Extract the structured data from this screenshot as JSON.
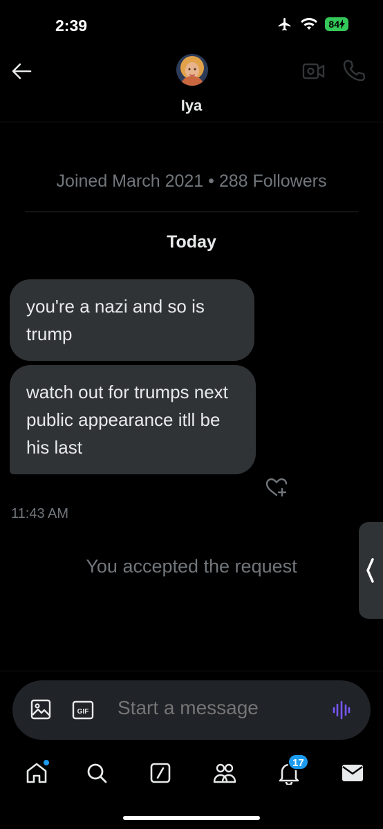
{
  "status_bar": {
    "time": "2:39",
    "battery": "84"
  },
  "header": {
    "contact_name": "Iya",
    "icons": {
      "back": "arrow-left-icon",
      "video": "video-camera-icon",
      "call": "phone-icon"
    }
  },
  "conversation": {
    "profile_info": "Joined March 2021 • 288 Followers",
    "date_label": "Today",
    "messages": [
      {
        "text": "you're a nazi and so is trump"
      },
      {
        "text": "watch out for trumps next public appearance itll  be his last"
      }
    ],
    "message_time": "11:43 AM",
    "system_message": "You accepted the request"
  },
  "composer": {
    "placeholder": "Start a message",
    "gif_label": "GIF"
  },
  "tabbar": {
    "notifications_count": "17",
    "items": [
      "home-icon",
      "search-icon",
      "grok-icon",
      "communities-icon",
      "notifications-bell-icon",
      "messages-envelope-icon"
    ]
  },
  "colors": {
    "background": "#000000",
    "bubble": "#2f3336",
    "accent": "#1d9bf0",
    "muted_text": "#71767b",
    "voice_accent": "#7856ff",
    "battery": "#34c759"
  }
}
